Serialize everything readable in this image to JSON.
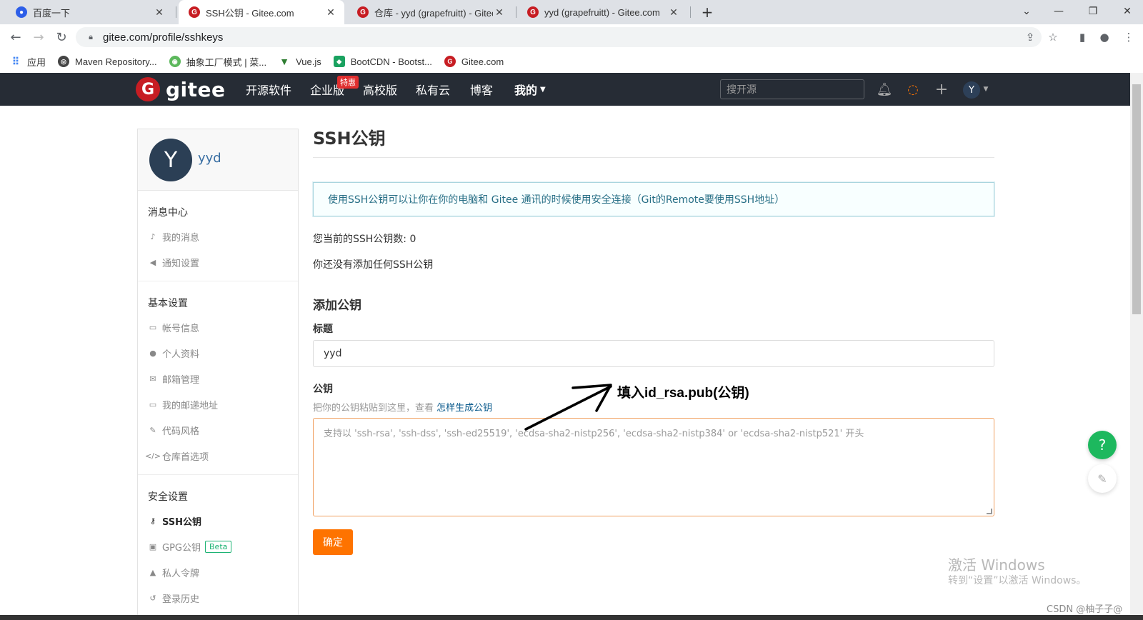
{
  "browser": {
    "tabs": [
      {
        "title": "百度一下",
        "icon": "baidu-paw-icon",
        "active": false
      },
      {
        "title": "SSH公钥 - Gitee.com",
        "icon": "gitee-g-icon",
        "active": true
      },
      {
        "title": "仓库 - yyd (grapefruitt) - Gitee",
        "icon": "gitee-g-icon",
        "active": false
      },
      {
        "title": "yyd (grapefruitt) - Gitee.com",
        "icon": "gitee-g-icon",
        "active": false
      }
    ],
    "url": "gitee.com/profile/sshkeys",
    "bookmarks": [
      {
        "label": "应用"
      },
      {
        "label": "Maven Repository..."
      },
      {
        "label": "抽象工厂模式 | 菜..."
      },
      {
        "label": "Vue.js"
      },
      {
        "label": "BootCDN - Bootst..."
      },
      {
        "label": "Gitee.com"
      }
    ]
  },
  "gitee_header": {
    "logo_text": "gitee",
    "nav": [
      {
        "label": "开源软件"
      },
      {
        "label": "企业版"
      },
      {
        "label": "高校版"
      },
      {
        "label": "私有云"
      },
      {
        "label": "博客"
      },
      {
        "label": "我的"
      }
    ],
    "hot_badge": "特惠",
    "search_placeholder": "搜开源",
    "avatar_letter": "Y"
  },
  "sidebar": {
    "avatar_letter": "Y",
    "username": "yyd",
    "groups": [
      {
        "title": "消息中心",
        "items": [
          {
            "label": "我的消息",
            "icon": "bell-icon"
          },
          {
            "label": "通知设置",
            "icon": "speaker-icon"
          }
        ]
      },
      {
        "title": "基本设置",
        "items": [
          {
            "label": "帐号信息",
            "icon": "id-card-icon"
          },
          {
            "label": "个人资料",
            "icon": "user-icon"
          },
          {
            "label": "邮箱管理",
            "icon": "envelope-icon"
          },
          {
            "label": "我的邮递地址",
            "icon": "address-card-icon"
          },
          {
            "label": "代码风格",
            "icon": "brush-icon"
          },
          {
            "label": "仓库首选项",
            "icon": "code-icon"
          }
        ]
      },
      {
        "title": "安全设置",
        "items": [
          {
            "label": "SSH公钥",
            "icon": "key-icon",
            "active": true
          },
          {
            "label": "GPG公钥",
            "icon": "lock-icon",
            "badge": "Beta"
          },
          {
            "label": "私人令牌",
            "icon": "token-icon"
          },
          {
            "label": "登录历史",
            "icon": "history-icon"
          }
        ]
      }
    ]
  },
  "main": {
    "title": "SSH公钥",
    "info": "使用SSH公钥可以让你在你的电脑和 Gitee 通讯的时候使用安全连接（Git的Remote要使用SSH地址）",
    "key_count_text": "您当前的SSH公钥数: 0",
    "empty_text": "你还没有添加任何SSH公钥",
    "add_section_title": "添加公钥",
    "title_label": "标题",
    "title_value": "yyd",
    "key_label": "公钥",
    "key_hint": "把你的公钥粘贴到这里，查看",
    "key_hint_link": "怎样生成公钥",
    "key_placeholder": "支持以 'ssh-rsa', 'ssh-dss', 'ssh-ed25519', 'ecdsa-sha2-nistp256', 'ecdsa-sha2-nistp384' or 'ecdsa-sha2-nistp521' 开头",
    "submit_label": "确定"
  },
  "annotation": "填入id_rsa.pub(公钥)",
  "help_fab": "?",
  "watermark": {
    "line1": "激活 Windows",
    "line2": "转到“设置”以激活 Windows。"
  },
  "csdn": "CSDN @柚子子@",
  "colors": {
    "gitee_red": "#c71d23",
    "header_bg": "#262c35",
    "submit_orange": "#fe7300",
    "info_text": "#276f86",
    "beta_green": "#1db374"
  }
}
